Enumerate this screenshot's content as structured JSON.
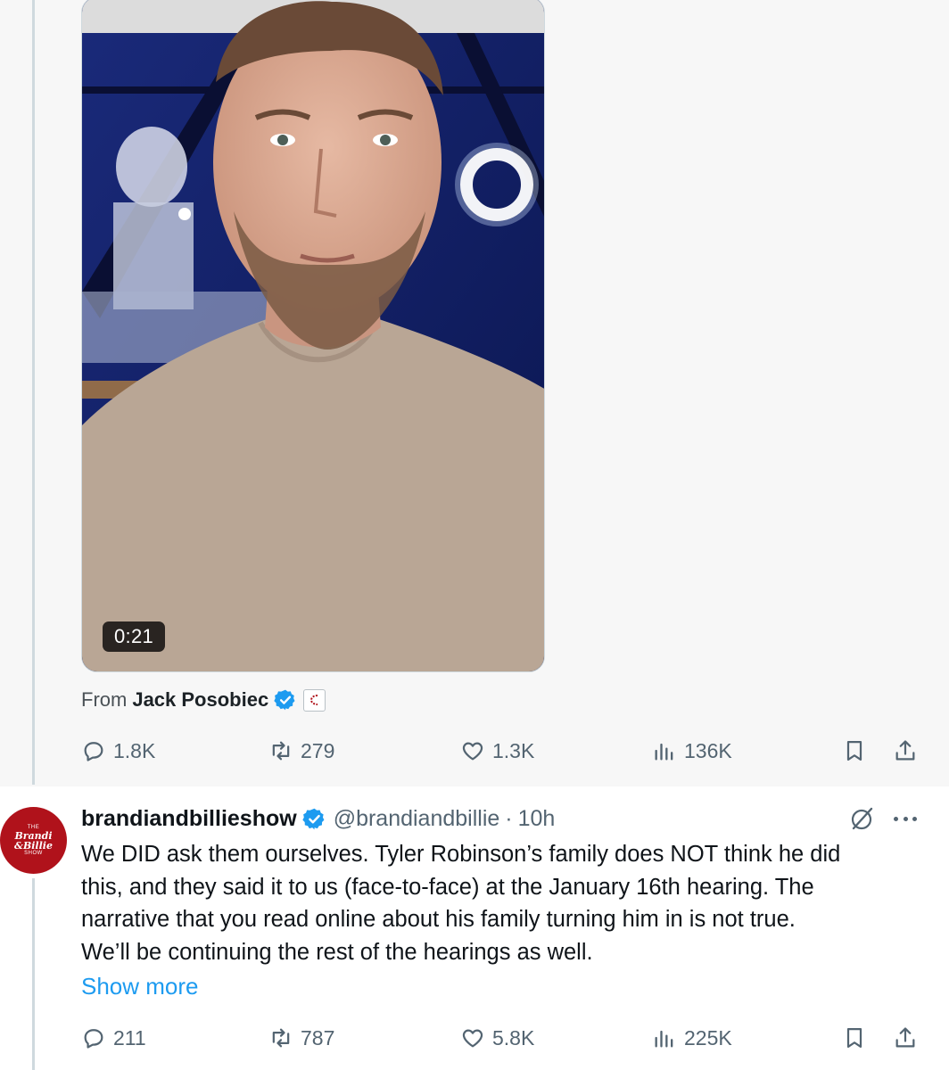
{
  "video": {
    "duration": "0:21",
    "from_label": "From",
    "from_name": "Jack Posobiec"
  },
  "tweet1_actions": {
    "replies": "1.8K",
    "reposts": "279",
    "likes": "1.3K",
    "views": "136K"
  },
  "tweet2": {
    "avatar_text_small_top": "THE",
    "avatar_text_line1": "Brandi",
    "avatar_text_line2": "&Billie",
    "avatar_text_small_bottom": "SHOW",
    "display_name": "brandiandbillieshow",
    "handle": "@brandiandbillie",
    "separator": "·",
    "time": "10h",
    "lines": [
      "We DID ask them ourselves. Tyler Robinson’s family does NOT think he did",
      "this, and they said it to us (face-to-face) at the January 16th hearing. The",
      "narrative that you read online about his family turning him in is not true.",
      "We’ll be continuing the rest of the hearings as well."
    ],
    "show_more": "Show more",
    "actions": {
      "replies": "211",
      "reposts": "787",
      "likes": "5.8K",
      "views": "225K"
    }
  },
  "colors": {
    "accent": "#1d9bf0",
    "muted": "#536471",
    "avatar_bg": "#b0121b"
  },
  "icons": [
    "reply-icon",
    "repost-icon",
    "like-icon",
    "views-icon",
    "bookmark-icon",
    "share-icon",
    "verified-icon",
    "grok-icon",
    "more-icon"
  ]
}
